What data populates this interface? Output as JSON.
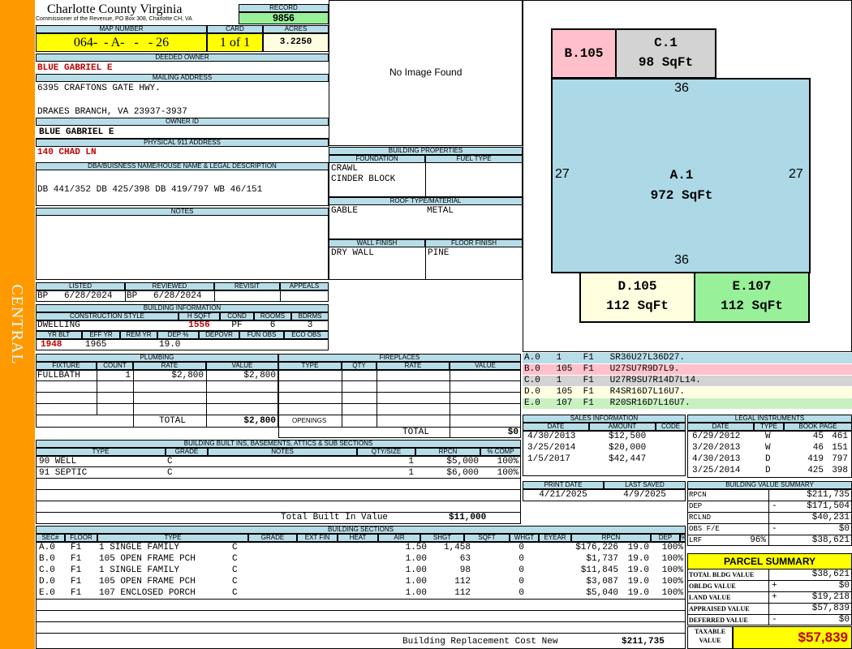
{
  "side_tab": "CENTRAL",
  "header": {
    "county": "Charlotte County Virginia",
    "commissioner": "Commissioner of the Revenue, PO Box 308, Charlotte CH, VA",
    "record_label": "RECORD",
    "record": "9856",
    "map_label": "MAP NUMBER",
    "map_number": "064-  - A-   -   - 26",
    "card_label": "CARD",
    "card": "1 of 1",
    "acres_label": "ACRES",
    "acres": "3.2250"
  },
  "owner": {
    "deeded_label": "DEEDED OWNER",
    "deeded_owner": "BLUE GABRIEL E",
    "mailing_label": "MAILING ADDRESS",
    "mail1": "6395 CRAFTONS GATE HWY.",
    "mail2": "DRAKES BRANCH, VA 23937-3937",
    "owner_id_label": "OWNER ID",
    "owner_id": "BLUE GABRIEL E",
    "physical_label": "PHYSICAL 911 ADDRESS",
    "physical": "140 CHAD LN",
    "dba_label": "DBA/BUISNESS NAME/HOUSE NAME & LEGAL DESCRIPTION",
    "legal": "DB 441/352 DB 425/398 DB 419/797 WB 46/151",
    "notes_label": "NOTES"
  },
  "image_text": "No Image Found",
  "listing": {
    "listed_label": "LISTED",
    "reviewed_label": "REVIEWED",
    "revisit_label": "REVISIT",
    "appeals_label": "APPEALS",
    "listed": "BP   6/28/2024",
    "reviewed": "BP   6/28/2024"
  },
  "building_info": {
    "label": "BUILDING INFORMATION",
    "style_label": "CONSTRUCTION STYLE",
    "hsqft_label": "H SQFT",
    "cond_label": "COND",
    "rooms_label": "ROOMS",
    "bdrms_label": "BDRMS",
    "style": "DWELLING",
    "hsqft": "1556",
    "cond": "PF",
    "rooms": "6",
    "bdrms": "3",
    "yrblt_label": "YR BLT",
    "effyr_label": "EFF YR",
    "remyr_label": "REM YR",
    "dep_label": "DEP %",
    "depovr_label": "DEPOVR",
    "funobs_label": "FUN OBS",
    "ecoobs_label": "ECO OBS",
    "yrblt": "1948",
    "effyr": "1965",
    "dep": "19.0"
  },
  "building_properties": {
    "label": "BUILDING PROPERTIES",
    "foundation_label": "FOUNDATION",
    "fuel_label": "FUEL TYPE",
    "foundation1": "CRAWL",
    "foundation2": "CINDER BLOCK",
    "roof_label": "ROOF TYPE/MATERIAL",
    "roof_type": "GABLE",
    "roof_material": "METAL",
    "wall_label": "WALL FINISH",
    "floor_label": "FLOOR FINISH",
    "wall": "DRY WALL",
    "floor": "PINE"
  },
  "sketch": {
    "b_label": "B.105",
    "c_label": "C.1",
    "c_area": "98 SqFt",
    "top_dim": "36",
    "left_dim": "27",
    "right_dim": "27",
    "a_label": "A.1",
    "a_area": "972 SqFt",
    "bottom_dim": "36",
    "d_label": "D.105",
    "d_area": "112 SqFt",
    "e_label": "E.107",
    "e_area": "112 SqFt"
  },
  "sketch_codes": [
    {
      "text": "A.0   1    F1   SR36U27L36D27.",
      "color": "#b7dde8"
    },
    {
      "text": "B.0   105  F1   U27SU7R9D7L9.",
      "color": "#ffc0cb"
    },
    {
      "text": "C.0   1    F1   U27R9SU7R14D7L14.",
      "color": "#d3d3d3"
    },
    {
      "text": "D.0   105  F1   R4SR16D7L16U7.",
      "color": "#ffffe0"
    },
    {
      "text": "E.0   107  F1   R20SR16D7L16U7.",
      "color": "#c8f0c0"
    }
  ],
  "plumbing": {
    "label": "PLUMBING",
    "fixture_label": "FIXTURE",
    "count_label": "COUNT",
    "rate_label": "RATE",
    "value_label": "VALUE",
    "fixture": "FULLBATH",
    "count": "1",
    "rate": "$2,800",
    "value": "$2,800",
    "total_label": "TOTAL",
    "total": "$2,800"
  },
  "fireplaces": {
    "label": "FIREPLACES",
    "type_label": "TYPE",
    "qty_label": "QTY",
    "rate_label": "RATE",
    "value_label": "VALUE",
    "openings_label": "OPENINGS",
    "total_label": "TOTAL",
    "total": "$0"
  },
  "sales": {
    "label": "SALES INFORMATION",
    "date_label": "DATE",
    "amount_label": "AMOUNT",
    "code_label": "CODE",
    "rows": [
      {
        "date": "4/30/2013",
        "amount": "$12,500"
      },
      {
        "date": "3/25/2014",
        "amount": "$20,000"
      },
      {
        "date": "1/5/2017",
        "amount": "$42,447"
      }
    ]
  },
  "legal_instruments": {
    "label": "LEGAL INSTRUMENTS",
    "date_label": "DATE",
    "type_label": "TYPE",
    "book_label": "BOOK PAGE",
    "rows": [
      {
        "date": "6/29/2012",
        "type": "W",
        "book": "45",
        "page": "461"
      },
      {
        "date": "3/20/2013",
        "type": "W",
        "book": "46",
        "page": "151"
      },
      {
        "date": "4/30/2013",
        "type": "D",
        "book": "419",
        "page": "797"
      },
      {
        "date": "3/25/2014",
        "type": "D",
        "book": "425",
        "page": "398"
      }
    ]
  },
  "built_ins": {
    "label": "BUILDING BUILT INS, BASEMENTS, ATTICS & SUB SECTIONS",
    "type_label": "TYPE",
    "grade_label": "GRADE",
    "notes_label": "NOTES",
    "qty_label": "QTY/SIZE",
    "rpcn_label": "RPCN",
    "comp_label": "% COMP",
    "rows": [
      {
        "type": "90 WELL",
        "grade": "C",
        "qty": "1",
        "rpcn": "$5,000",
        "comp": "100%"
      },
      {
        "type": "91 SEPTIC",
        "grade": "C",
        "qty": "1",
        "rpcn": "$6,000",
        "comp": "100%"
      }
    ],
    "total_label": "Total Built In Value",
    "total": "$11,000"
  },
  "print": {
    "print_label": "PRINT DATE",
    "saved_label": "LAST SAVED",
    "print_date": "4/21/2025",
    "saved_date": "4/9/2025"
  },
  "value_summary": {
    "label": "BUILDING VALUE SUMMARY",
    "rpcn_label": "RPCN",
    "rpcn": "$211,735",
    "dep_label": "DEP",
    "dep_sign": "-",
    "dep": "$171,504",
    "rclnd_label": "RCLND",
    "rclnd": "$40,231",
    "obs_label": "OBS F/E",
    "obs_sign": "-",
    "obs": "$0",
    "lrf_label": "LRF",
    "lrf_pct": "96%",
    "lrf": "$38,621"
  },
  "sections": {
    "label": "BUILDING SECTIONS",
    "headers": [
      "SEC#",
      "FLOOR",
      "TYPE",
      "GRADE",
      "EXT FIN",
      "HEAT",
      "AIR",
      "SHGT",
      "SQFT",
      "WHGT",
      "EYEAR",
      "RPCN",
      "DEP",
      "% COMP"
    ],
    "rows": [
      {
        "sec": "A.0",
        "floor": "F1",
        "type": "1 SINGLE FAMILY",
        "grade": "C",
        "shgt": "1.50",
        "sqft": "1,458",
        "whgt": "0",
        "rpcn": "$176,226",
        "dep": "19.0",
        "comp": "100%"
      },
      {
        "sec": "B.0",
        "floor": "F1",
        "type": "105 OPEN FRAME PCH",
        "grade": "C",
        "shgt": "1.00",
        "sqft": "63",
        "whgt": "0",
        "rpcn": "$1,737",
        "dep": "19.0",
        "comp": "100%"
      },
      {
        "sec": "C.0",
        "floor": "F1",
        "type": "1 SINGLE FAMILY",
        "grade": "C",
        "shgt": "1.00",
        "sqft": "98",
        "whgt": "0",
        "rpcn": "$11,845",
        "dep": "19.0",
        "comp": "100%"
      },
      {
        "sec": "D.0",
        "floor": "F1",
        "type": "105 OPEN FRAME PCH",
        "grade": "C",
        "shgt": "1.00",
        "sqft": "112",
        "whgt": "0",
        "rpcn": "$3,087",
        "dep": "19.0",
        "comp": "100%"
      },
      {
        "sec": "E.0",
        "floor": "F1",
        "type": "107 ENCLOSED PORCH",
        "grade": "C",
        "shgt": "1.00",
        "sqft": "112",
        "whgt": "0",
        "rpcn": "$5,040",
        "dep": "19.0",
        "comp": "100%"
      }
    ],
    "total_label": "Building Replacement Cost New",
    "total": "$211,735"
  },
  "parcel": {
    "label": "PARCEL SUMMARY",
    "bldg_label": "TOTAL BLDG VALUE",
    "bldg": "$38,621",
    "obldg_label": "OBLDG VALUE",
    "obldg_sign": "+",
    "obldg": "$0",
    "land_label": "LAND VALUE",
    "land_sign": "+",
    "land": "$19,218",
    "appraised_label": "APPRAISED VALUE",
    "appraised": "$57,839",
    "deferred_label": "DEFERRED VALUE",
    "deferred_sign": "-",
    "deferred": "$0",
    "taxable_label1": "TAXABLE",
    "taxable_label2": "VALUE",
    "taxable": "$57,839"
  },
  "colors": {
    "side_tab": "#ff9900",
    "header_blue": "#b7dde8",
    "yellow": "#ffff00",
    "green": "#98f098",
    "red_text": "#c00000"
  }
}
